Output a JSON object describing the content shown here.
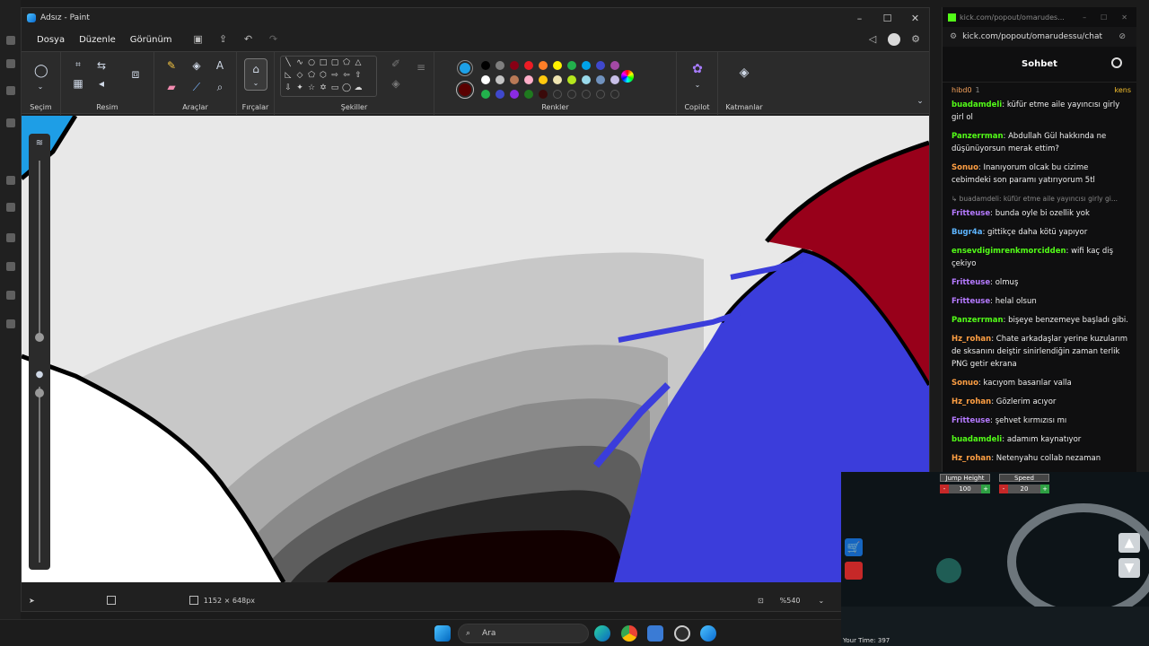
{
  "paint": {
    "title": "Adsız - Paint",
    "window_controls": [
      "–",
      "☐",
      "✕"
    ],
    "menu": [
      "Dosya",
      "Düzenle",
      "Görünüm"
    ],
    "ribbon_groups": {
      "selection": "Seçim",
      "image": "Resim",
      "tools": "Araçlar",
      "brushes": "Fırçalar",
      "shapes": "Şekiller",
      "colors": "Renkler",
      "copilot": "Copilot",
      "layers": "Katmanlar"
    },
    "palette_row1": [
      "#000000",
      "#7f7f7f",
      "#880015",
      "#ed1c24",
      "#ff7f27",
      "#fff200",
      "#22b14c",
      "#00a2e8",
      "#3f48cc",
      "#a349a4"
    ],
    "palette_row2": [
      "#ffffff",
      "#c3c3c3",
      "#b97a57",
      "#ffaec9",
      "#ffc90e",
      "#efe4b0",
      "#b5e61d",
      "#99d9ea",
      "#7092be",
      "#c8bfe7"
    ],
    "palette_row3": [
      "#22b14c",
      "#3f48cc",
      "#8a2be2",
      "#1f7a1f",
      "#3a0a0a"
    ],
    "primary_color": "#1da1e8",
    "secondary_color": "#5a0000",
    "status": {
      "canvas_size": "1152 × 648px",
      "zoom": "%540"
    }
  },
  "chat": {
    "tab_title": "kick.com/popout/omarudes...",
    "url": "kick.com/popout/omarudessu/chat",
    "header": "Sohbet",
    "pinned": {
      "user": "hibd0",
      "badge": "1",
      "extra": "kens"
    },
    "messages": [
      {
        "user": "buadamdeli",
        "color": "#53fc18",
        "text": "küfür etme aile yayıncısı girly girl ol"
      },
      {
        "user": "Panzerrman",
        "color": "#53fc18",
        "text": "Abdullah Gül hakkında ne düşünüyorsun merak ettim?"
      },
      {
        "user": "Sonuo",
        "color": "#ff9f43",
        "text": "Inanıyorum olcak bu cizime cebimdeki son paramı yatırıyorum 5tl"
      },
      {
        "reply": true,
        "text": "↳ buadamdeli: küfür etme aile yayıncısı girly gi..."
      },
      {
        "user": "Fritteuse",
        "color": "#b57aff",
        "text": "bunda oyle bi ozellik yok"
      },
      {
        "user": "Bugr4a",
        "color": "#5db5ff",
        "text": "gittikçe daha kötü yapıyor"
      },
      {
        "user": "ensevdigimrenkmorcidden",
        "color": "#53fc18",
        "text": "wifi kaç diş çekiyo"
      },
      {
        "user": "Fritteuse",
        "color": "#b57aff",
        "text": "olmuş"
      },
      {
        "user": "Fritteuse",
        "color": "#b57aff",
        "text": "helal olsun"
      },
      {
        "user": "Panzerrman",
        "color": "#53fc18",
        "text": "bişeye benzemeye başladı gibi."
      },
      {
        "user": "Hz_rohan",
        "color": "#ff9f43",
        "text": "Chate arkadaşlar yerine kuzularım de sksanını deiştir sinirlendiğin zaman terlik PNG getir ekrana"
      },
      {
        "user": "Sonuo",
        "color": "#ff9f43",
        "text": "kacıyom basarılar valla"
      },
      {
        "user": "Hz_rohan",
        "color": "#ff9f43",
        "text": "Gözlerim acıyor"
      },
      {
        "user": "Fritteuse",
        "color": "#b57aff",
        "text": "şehvet kırmızısı mı"
      },
      {
        "user": "buadamdeli",
        "color": "#53fc18",
        "text": "adamım kaynatıyor"
      },
      {
        "user": "Hz_rohan",
        "color": "#ff9f43",
        "text": "Netenyahu collab nezaman"
      }
    ]
  },
  "game": {
    "jump_label": "Jump Height",
    "jump_value": "100",
    "speed_label": "Speed",
    "speed_value": "20",
    "minus": "-",
    "plus": "+",
    "time": "Your Time:  397"
  },
  "taskbar": {
    "search_placeholder": "Ara"
  }
}
